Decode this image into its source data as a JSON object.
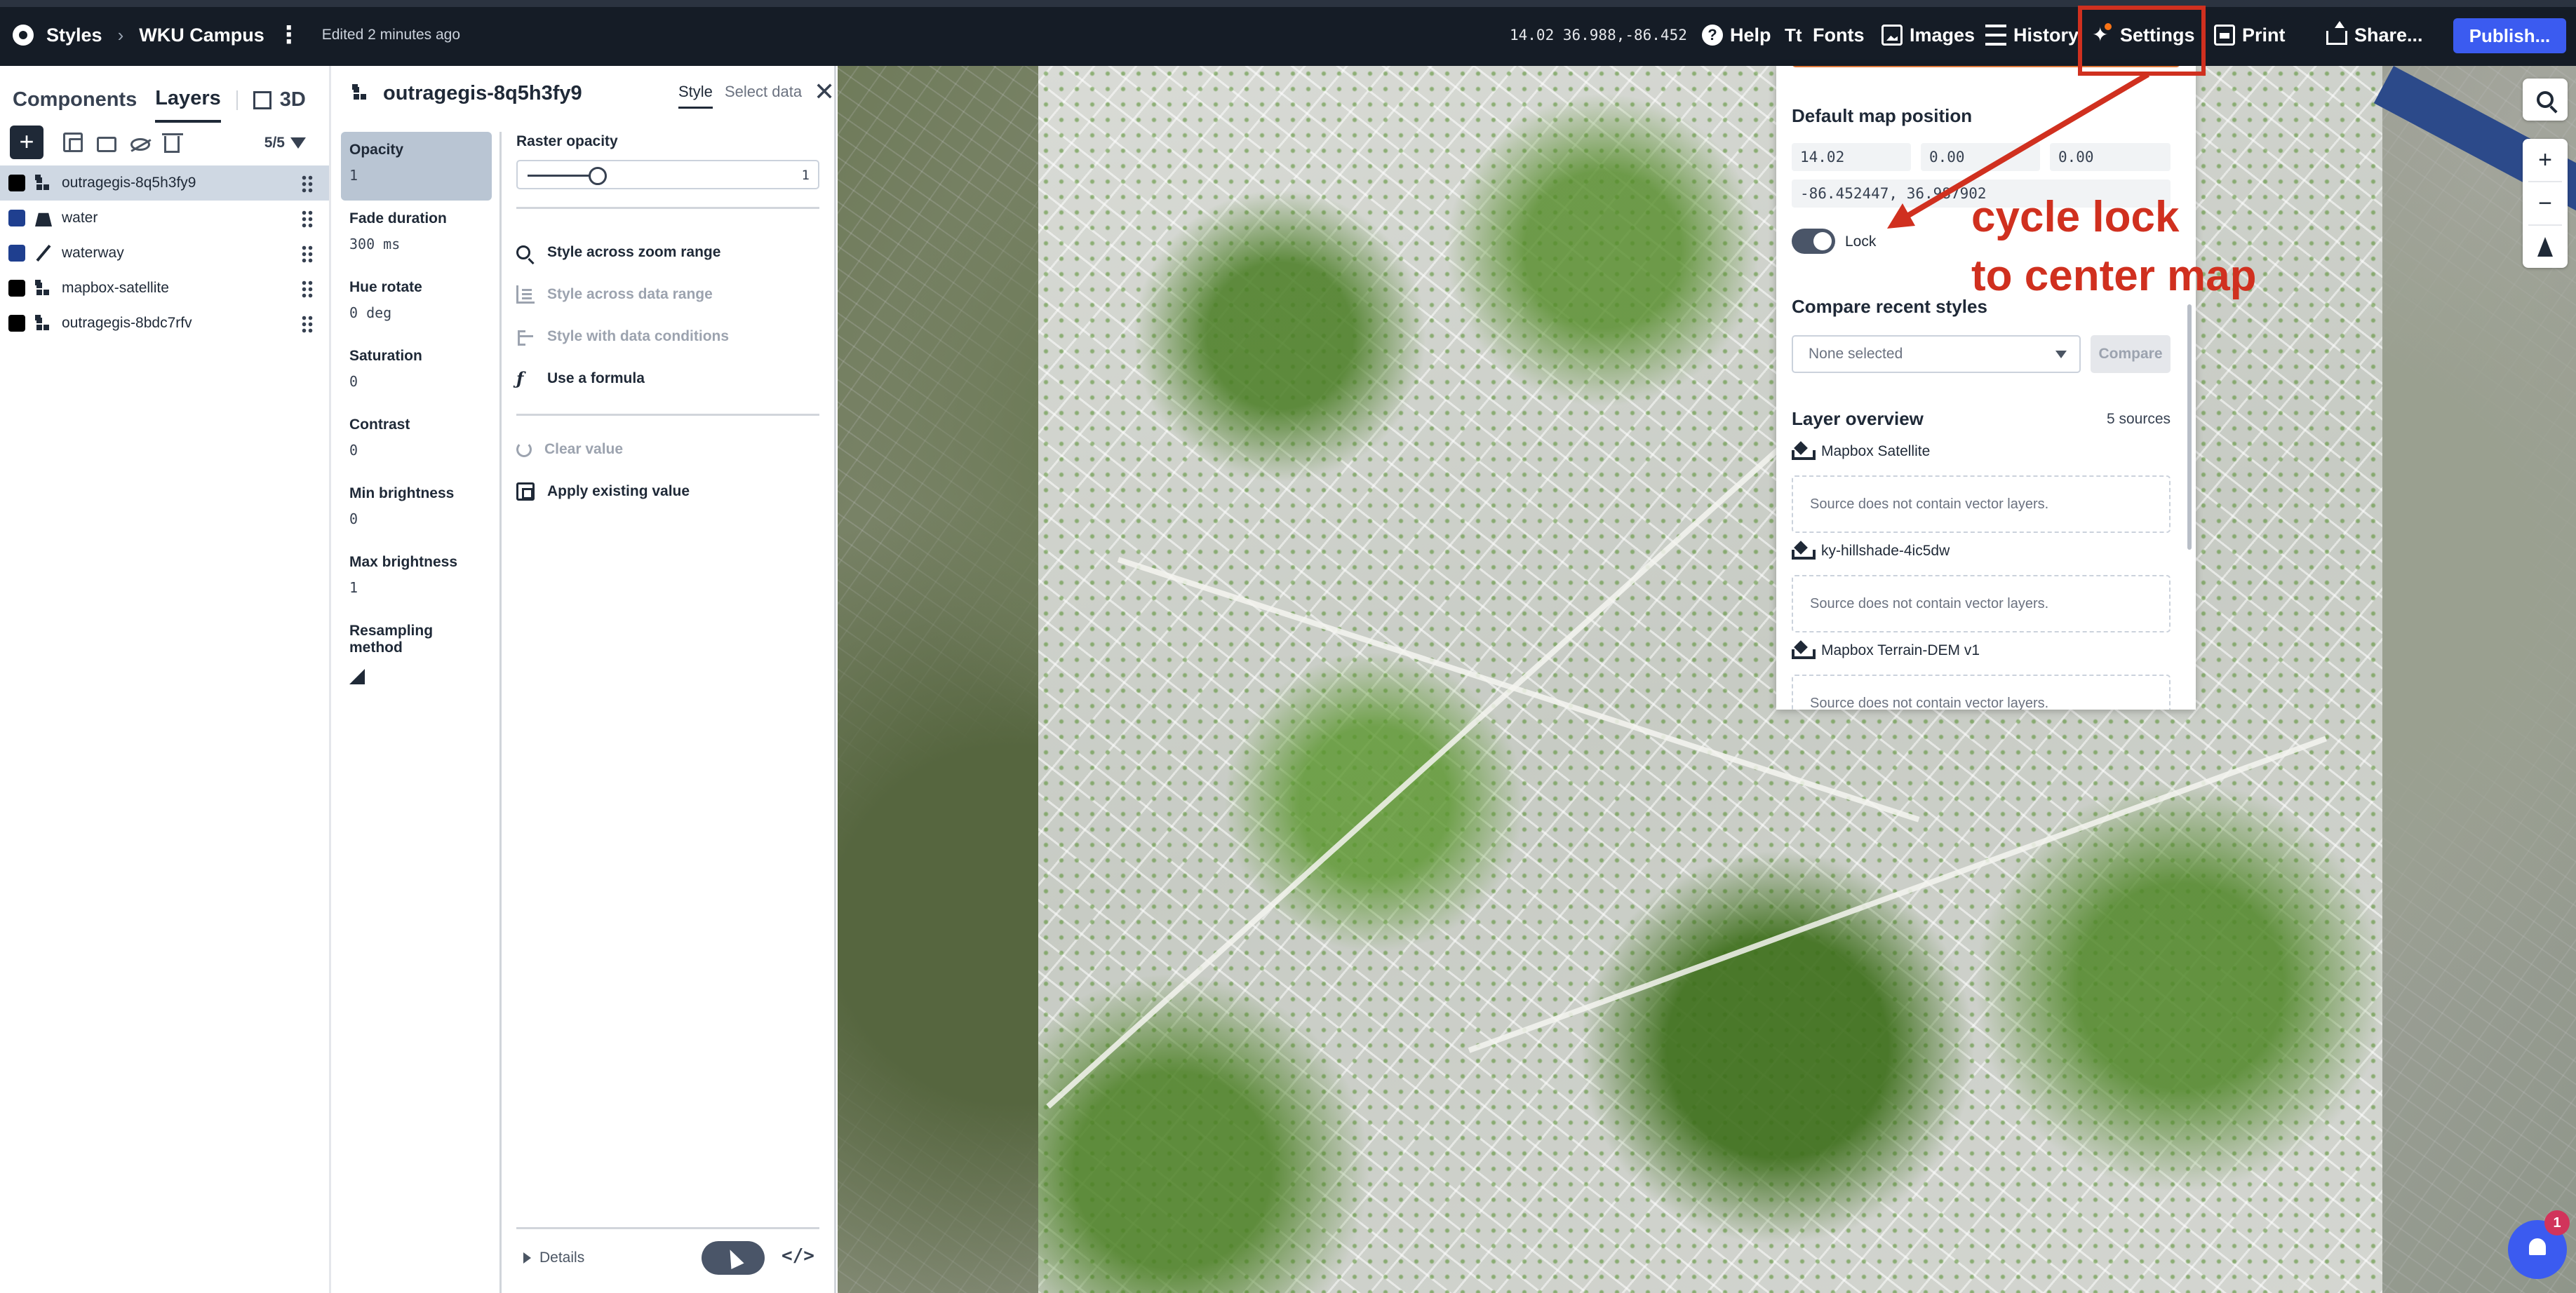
{
  "topbar": {
    "styles_label": "Styles",
    "style_name": "WKU Campus",
    "edited_text": "Edited 2 minutes ago",
    "map_position": "14.02 36.988,-86.452",
    "help_label": "Help",
    "fonts_label": "Fonts",
    "images_label": "Images",
    "history_label": "History",
    "settings_label": "Settings",
    "print_label": "Print",
    "share_label": "Share...",
    "publish_label": "Publish..."
  },
  "left_panel": {
    "tab_components": "Components",
    "tab_layers": "Layers",
    "tab_3d": "3D",
    "layer_count": "5/5",
    "layers": [
      {
        "name": "outragegis-8q5h3fy9",
        "type": "raster",
        "color": "#000000",
        "selected": true
      },
      {
        "name": "water",
        "type": "fill",
        "color": "#1f3f8f",
        "selected": false
      },
      {
        "name": "waterway",
        "type": "line",
        "color": "#1f3f8f",
        "selected": false
      },
      {
        "name": "mapbox-satellite",
        "type": "raster",
        "color": "#000000",
        "selected": false
      },
      {
        "name": "outragegis-8bdc7rfv",
        "type": "raster",
        "color": "#000000",
        "selected": false
      }
    ]
  },
  "properties": {
    "layer_title": "outragegis-8q5h3fy9",
    "tab_style": "Style",
    "tab_select_data": "Select data",
    "items": [
      {
        "name": "Opacity",
        "value": "1"
      },
      {
        "name": "Fade duration",
        "value": "300 ms"
      },
      {
        "name": "Hue rotate",
        "value": "0 deg"
      },
      {
        "name": "Saturation",
        "value": "0"
      },
      {
        "name": "Contrast",
        "value": "0"
      },
      {
        "name": "Min brightness",
        "value": "0"
      },
      {
        "name": "Max brightness",
        "value": "1"
      },
      {
        "name": "Resampling method",
        "value": ""
      }
    ],
    "raster_opacity_label": "Raster opacity",
    "raster_opacity_value": "1",
    "raster_opacity_fraction": 0.25,
    "options": {
      "zoom_range": "Style across zoom range",
      "data_range": "Style across data range",
      "data_conditions": "Style with data conditions",
      "formula": "Use a formula",
      "clear_value": "Clear value",
      "apply_existing": "Apply existing value"
    },
    "details_label": "Details",
    "code_label": "</>"
  },
  "settings": {
    "default_position_title": "Default map position",
    "zoom": "14.02",
    "bearing": "0.00",
    "pitch": "0.00",
    "center": "-86.452447, 36.987902",
    "lock_label": "Lock",
    "compare_title": "Compare recent styles",
    "compare_placeholder": "None selected",
    "compare_button": "Compare",
    "layer_overview_title": "Layer overview",
    "sources_count": "5 sources",
    "sources": [
      {
        "name": "Mapbox Satellite",
        "note": "Source does not contain vector layers."
      },
      {
        "name": "ky-hillshade-4ic5dw",
        "note": "Source does not contain vector layers."
      },
      {
        "name": "Mapbox Terrain-DEM v1",
        "note": "Source does not contain vector layers."
      }
    ]
  },
  "annotation": {
    "line1": "cycle lock",
    "line2": "to center map",
    "color": "#d0301f"
  },
  "notifications": {
    "count": "1"
  },
  "icons": [
    "mapbox-logo-icon",
    "chevron-right-icon",
    "more-vertical-icon",
    "help-icon",
    "fonts-icon",
    "images-icon",
    "history-icon",
    "settings-icon",
    "print-icon",
    "share-icon",
    "search-icon",
    "zoom-in-icon",
    "zoom-out-icon",
    "compass-icon",
    "bell-icon"
  ]
}
